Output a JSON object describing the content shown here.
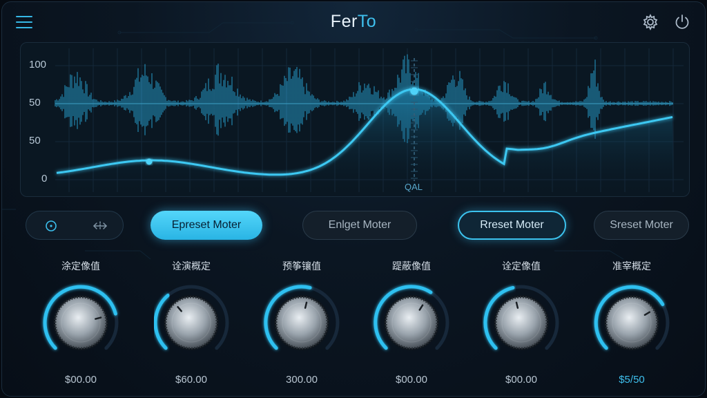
{
  "header": {
    "title_main": "Fer",
    "title_accent": "To",
    "menu_icon": "hamburger-icon",
    "settings_icon": "gear-icon",
    "power_icon": "power-icon"
  },
  "waveform": {
    "y_ticks": [
      "100",
      "50",
      "50",
      "0"
    ],
    "marker_label": "QAL",
    "colors": {
      "wave": "#2aa6d6",
      "curve": "#3cc8f2",
      "grid": "#14283a"
    }
  },
  "control_pill": {
    "icon_left": "target-icon",
    "icon_right": "swap-arrows-icon"
  },
  "preset_buttons": [
    {
      "label": "Epreset Moter",
      "state": "active"
    },
    {
      "label": "Enlget Moter",
      "state": "normal"
    },
    {
      "label": "Rreset Moter",
      "state": "selected"
    },
    {
      "label": "Sreset Moter",
      "state": "normal"
    }
  ],
  "knobs": [
    {
      "label": "涂定像值",
      "value": "$00.00",
      "level": 0.78
    },
    {
      "label": "诠演概定",
      "value": "$60.00",
      "level": 0.35
    },
    {
      "label": "预筝镶值",
      "value": "300.00",
      "level": 0.55
    },
    {
      "label": "踶蔽像值",
      "value": "$00.00",
      "level": 0.62
    },
    {
      "label": "诠定像值",
      "value": "$00.00",
      "level": 0.45
    },
    {
      "label": "准宰概定",
      "value": "$5/50",
      "level": 0.72,
      "highlight": true
    }
  ]
}
